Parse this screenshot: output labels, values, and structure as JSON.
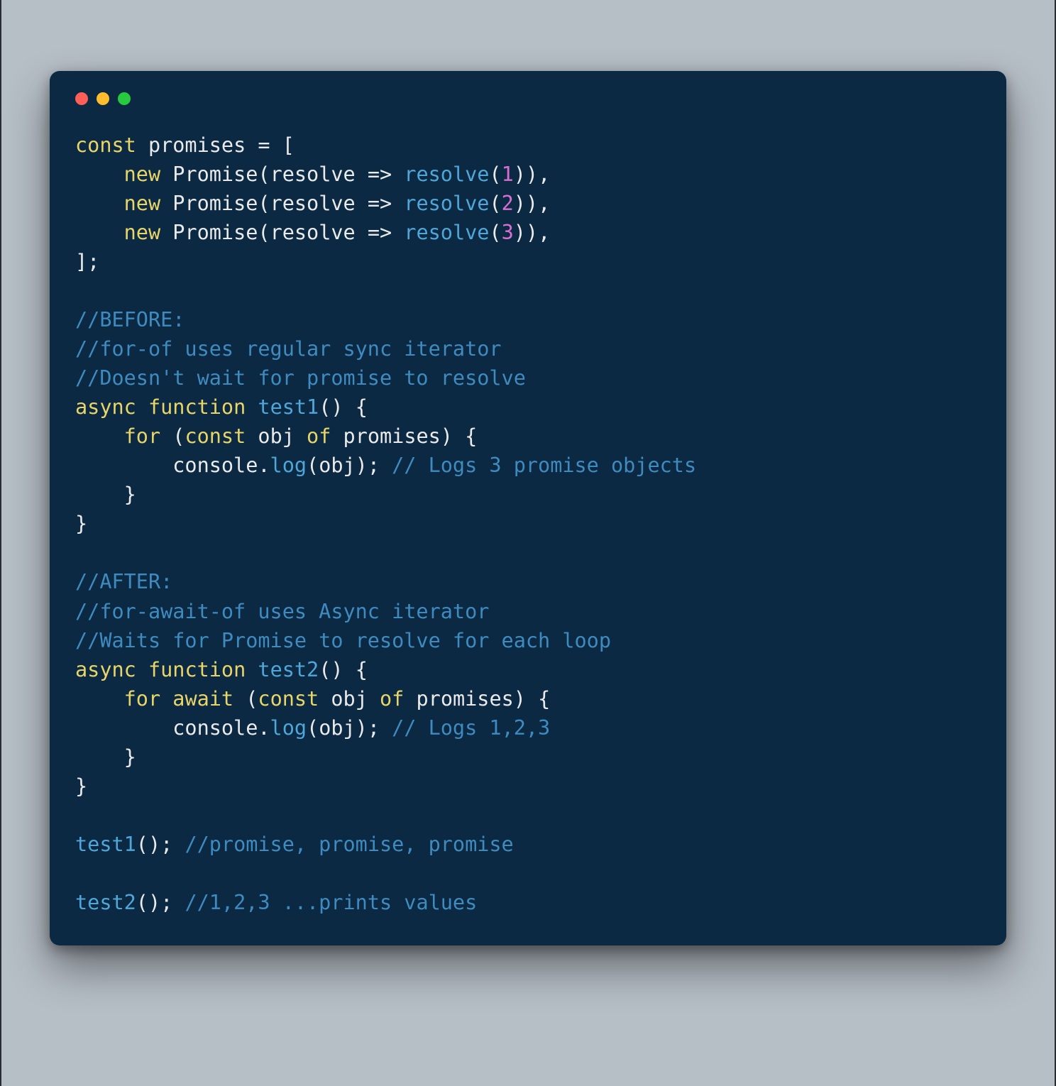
{
  "tokens": [
    {
      "t": "const",
      "c": "tok-kw"
    },
    {
      "t": " promises = [\n",
      "c": "tok-default"
    },
    {
      "t": "    ",
      "c": "tok-default"
    },
    {
      "t": "new",
      "c": "tok-kw"
    },
    {
      "t": " ",
      "c": "tok-default"
    },
    {
      "t": "Promise",
      "c": "tok-default"
    },
    {
      "t": "(resolve => ",
      "c": "tok-default"
    },
    {
      "t": "resolve",
      "c": "tok-fn"
    },
    {
      "t": "(",
      "c": "tok-default"
    },
    {
      "t": "1",
      "c": "tok-num"
    },
    {
      "t": ")),\n",
      "c": "tok-default"
    },
    {
      "t": "    ",
      "c": "tok-default"
    },
    {
      "t": "new",
      "c": "tok-kw"
    },
    {
      "t": " ",
      "c": "tok-default"
    },
    {
      "t": "Promise",
      "c": "tok-default"
    },
    {
      "t": "(resolve => ",
      "c": "tok-default"
    },
    {
      "t": "resolve",
      "c": "tok-fn"
    },
    {
      "t": "(",
      "c": "tok-default"
    },
    {
      "t": "2",
      "c": "tok-num"
    },
    {
      "t": ")),\n",
      "c": "tok-default"
    },
    {
      "t": "    ",
      "c": "tok-default"
    },
    {
      "t": "new",
      "c": "tok-kw"
    },
    {
      "t": " ",
      "c": "tok-default"
    },
    {
      "t": "Promise",
      "c": "tok-default"
    },
    {
      "t": "(resolve => ",
      "c": "tok-default"
    },
    {
      "t": "resolve",
      "c": "tok-fn"
    },
    {
      "t": "(",
      "c": "tok-default"
    },
    {
      "t": "3",
      "c": "tok-num"
    },
    {
      "t": ")),\n",
      "c": "tok-default"
    },
    {
      "t": "];\n",
      "c": "tok-default"
    },
    {
      "t": "\n",
      "c": "tok-default"
    },
    {
      "t": "//BEFORE:\n",
      "c": "tok-comment"
    },
    {
      "t": "//for-of uses regular sync iterator\n",
      "c": "tok-comment"
    },
    {
      "t": "//Doesn't wait for promise to resolve\n",
      "c": "tok-comment"
    },
    {
      "t": "async",
      "c": "tok-kw"
    },
    {
      "t": " ",
      "c": "tok-default"
    },
    {
      "t": "function",
      "c": "tok-kw"
    },
    {
      "t": " ",
      "c": "tok-default"
    },
    {
      "t": "test1",
      "c": "tok-fn"
    },
    {
      "t": "() {\n",
      "c": "tok-default"
    },
    {
      "t": "    ",
      "c": "tok-default"
    },
    {
      "t": "for",
      "c": "tok-kw"
    },
    {
      "t": " (",
      "c": "tok-default"
    },
    {
      "t": "const",
      "c": "tok-kw"
    },
    {
      "t": " obj ",
      "c": "tok-default"
    },
    {
      "t": "of",
      "c": "tok-kw"
    },
    {
      "t": " promises) {\n",
      "c": "tok-default"
    },
    {
      "t": "        console.",
      "c": "tok-default"
    },
    {
      "t": "log",
      "c": "tok-fn"
    },
    {
      "t": "(obj); ",
      "c": "tok-default"
    },
    {
      "t": "// Logs 3 promise objects\n",
      "c": "tok-comment"
    },
    {
      "t": "    }\n",
      "c": "tok-default"
    },
    {
      "t": "}\n",
      "c": "tok-default"
    },
    {
      "t": "\n",
      "c": "tok-default"
    },
    {
      "t": "//AFTER:\n",
      "c": "tok-comment"
    },
    {
      "t": "//for-await-of uses Async iterator\n",
      "c": "tok-comment"
    },
    {
      "t": "//Waits for Promise to resolve for each loop\n",
      "c": "tok-comment"
    },
    {
      "t": "async",
      "c": "tok-kw"
    },
    {
      "t": " ",
      "c": "tok-default"
    },
    {
      "t": "function",
      "c": "tok-kw"
    },
    {
      "t": " ",
      "c": "tok-default"
    },
    {
      "t": "test2",
      "c": "tok-fn"
    },
    {
      "t": "() {\n",
      "c": "tok-default"
    },
    {
      "t": "    ",
      "c": "tok-default"
    },
    {
      "t": "for",
      "c": "tok-kw"
    },
    {
      "t": " ",
      "c": "tok-default"
    },
    {
      "t": "await",
      "c": "tok-kw"
    },
    {
      "t": " (",
      "c": "tok-default"
    },
    {
      "t": "const",
      "c": "tok-kw"
    },
    {
      "t": " obj ",
      "c": "tok-default"
    },
    {
      "t": "of",
      "c": "tok-kw"
    },
    {
      "t": " promises) {\n",
      "c": "tok-default"
    },
    {
      "t": "        console.",
      "c": "tok-default"
    },
    {
      "t": "log",
      "c": "tok-fn"
    },
    {
      "t": "(obj); ",
      "c": "tok-default"
    },
    {
      "t": "// Logs 1,2,3\n",
      "c": "tok-comment"
    },
    {
      "t": "    }\n",
      "c": "tok-default"
    },
    {
      "t": "}\n",
      "c": "tok-default"
    },
    {
      "t": "\n",
      "c": "tok-default"
    },
    {
      "t": "test1",
      "c": "tok-fn"
    },
    {
      "t": "(); ",
      "c": "tok-default"
    },
    {
      "t": "//promise, promise, promise\n",
      "c": "tok-comment"
    },
    {
      "t": "\n",
      "c": "tok-default"
    },
    {
      "t": "test2",
      "c": "tok-fn"
    },
    {
      "t": "(); ",
      "c": "tok-default"
    },
    {
      "t": "//1,2,3 ...prints values",
      "c": "tok-comment"
    }
  ]
}
